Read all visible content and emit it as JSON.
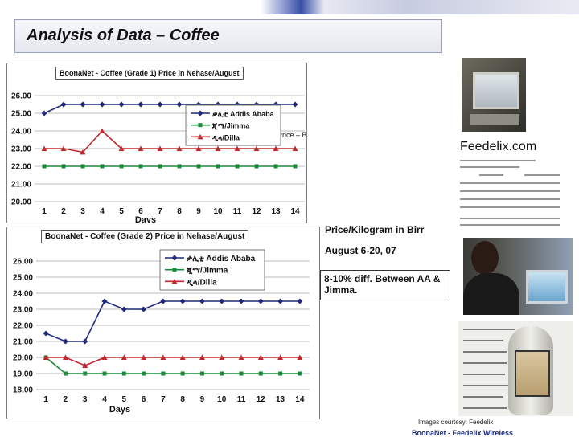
{
  "slide": {
    "title": "Analysis of Data – Coffee",
    "info_unit": "Price/Kilogram in Birr",
    "info_date": "August 6-20, 07",
    "info_diff": "8-10% diff. Between AA & Jimma.",
    "credit": "Images courtesy: Feedelix",
    "footer": "BoonaNet - Feedelix Wireless"
  },
  "chart_data": [
    {
      "type": "line",
      "title": "BoonaNet - Coffee (Grade 1) Price in Nehase/August",
      "xlabel": "Days",
      "ylabel": "Price – Birr/Kg",
      "x": [
        1,
        2,
        3,
        4,
        5,
        6,
        7,
        8,
        9,
        10,
        11,
        12,
        13,
        14
      ],
      "ylim": [
        20,
        26
      ],
      "yticks": [
        "20.00",
        "21.00",
        "22.00",
        "23.00",
        "24.00",
        "25.00",
        "26.00"
      ],
      "series": [
        {
          "name": "ቃሊቲ Addis Ababa",
          "color": "#1f2a7a",
          "marker": "diamond",
          "values": [
            25,
            25.5,
            25.5,
            25.5,
            25.5,
            25.5,
            25.5,
            25.5,
            25.5,
            25.5,
            25.5,
            25.5,
            25.5,
            25.5
          ]
        },
        {
          "name": "ጂማ/Jimma",
          "color": "#1a8a3a",
          "marker": "square",
          "values": [
            22,
            22,
            22,
            22,
            22,
            22,
            22,
            22,
            22,
            22,
            22,
            22,
            22,
            22
          ]
        },
        {
          "name": "ዲላ/Dilla",
          "color": "#c0282d",
          "marker": "triangle",
          "values": [
            23,
            23,
            22.8,
            24,
            23,
            23,
            23,
            23,
            23,
            23,
            23,
            23,
            23,
            23
          ]
        }
      ],
      "legend": "top-right",
      "grid": "horizontal"
    },
    {
      "type": "line",
      "title": "BoonaNet - Coffee (Grade 2) Price in Nehase/August",
      "xlabel": "Days",
      "x": [
        1,
        2,
        3,
        4,
        5,
        6,
        7,
        8,
        9,
        10,
        11,
        12,
        13,
        14
      ],
      "ylim": [
        18,
        26
      ],
      "yticks": [
        "18.00",
        "19.00",
        "20.00",
        "21.00",
        "22.00",
        "23.00",
        "24.00",
        "25.00",
        "26.00"
      ],
      "series": [
        {
          "name": "ቃሊቲ Addis Ababa",
          "color": "#1f2a7a",
          "marker": "diamond",
          "values": [
            21.5,
            21,
            21,
            23.5,
            23,
            23,
            23.5,
            23.5,
            23.5,
            23.5,
            23.5,
            23.5,
            23.5,
            23.5
          ]
        },
        {
          "name": "ጂማ/Jimma",
          "color": "#1a8a3a",
          "marker": "square",
          "values": [
            20,
            19,
            19,
            19,
            19,
            19,
            19,
            19,
            19,
            19,
            19,
            19,
            19,
            19
          ]
        },
        {
          "name": "ዲላ/Dilla",
          "color": "#c0282d",
          "marker": "triangle",
          "values": [
            20,
            20,
            19.5,
            20,
            20,
            20,
            20,
            20,
            20,
            20,
            20,
            20,
            20,
            20
          ]
        }
      ],
      "legend": "top-right",
      "grid": "horizontal"
    }
  ],
  "phone_screen": {
    "title": "Feedelix.com"
  }
}
